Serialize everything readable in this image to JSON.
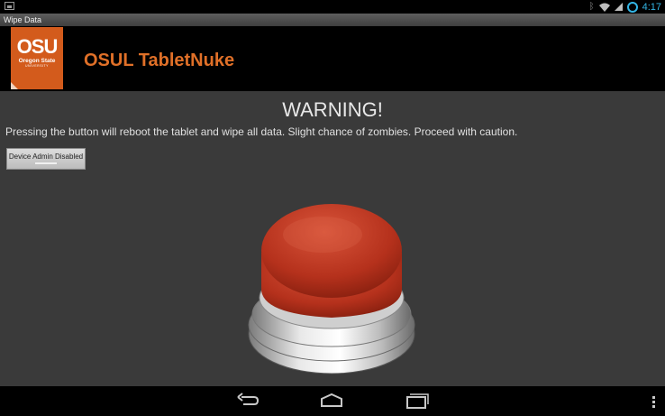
{
  "status_bar": {
    "time": "4:17",
    "icons": [
      "notification-icon",
      "bluetooth-icon",
      "wifi-icon",
      "signal-icon",
      "sync-icon"
    ],
    "accent": "#33b5e5"
  },
  "window": {
    "title": "Wipe Data"
  },
  "header": {
    "logo": {
      "big": "OSU",
      "line1": "Oregon State",
      "line2": "UNIVERSITY",
      "color": "#d35b1c"
    },
    "app_title": "OSUL TabletNuke",
    "title_color": "#e07028"
  },
  "main": {
    "warning_title": "WARNING!",
    "warning_text": "Pressing the button will reboot the tablet and wipe all data. Slight chance of zombies. Proceed with caution.",
    "admin_button_label": "Device Admin Disabled",
    "nuke_button": {
      "icon": "big-red-button-icon",
      "color": "#c63a22"
    }
  },
  "nav_bar": {
    "icons": [
      "back-icon",
      "home-icon",
      "recent-apps-icon",
      "menu-icon"
    ]
  }
}
